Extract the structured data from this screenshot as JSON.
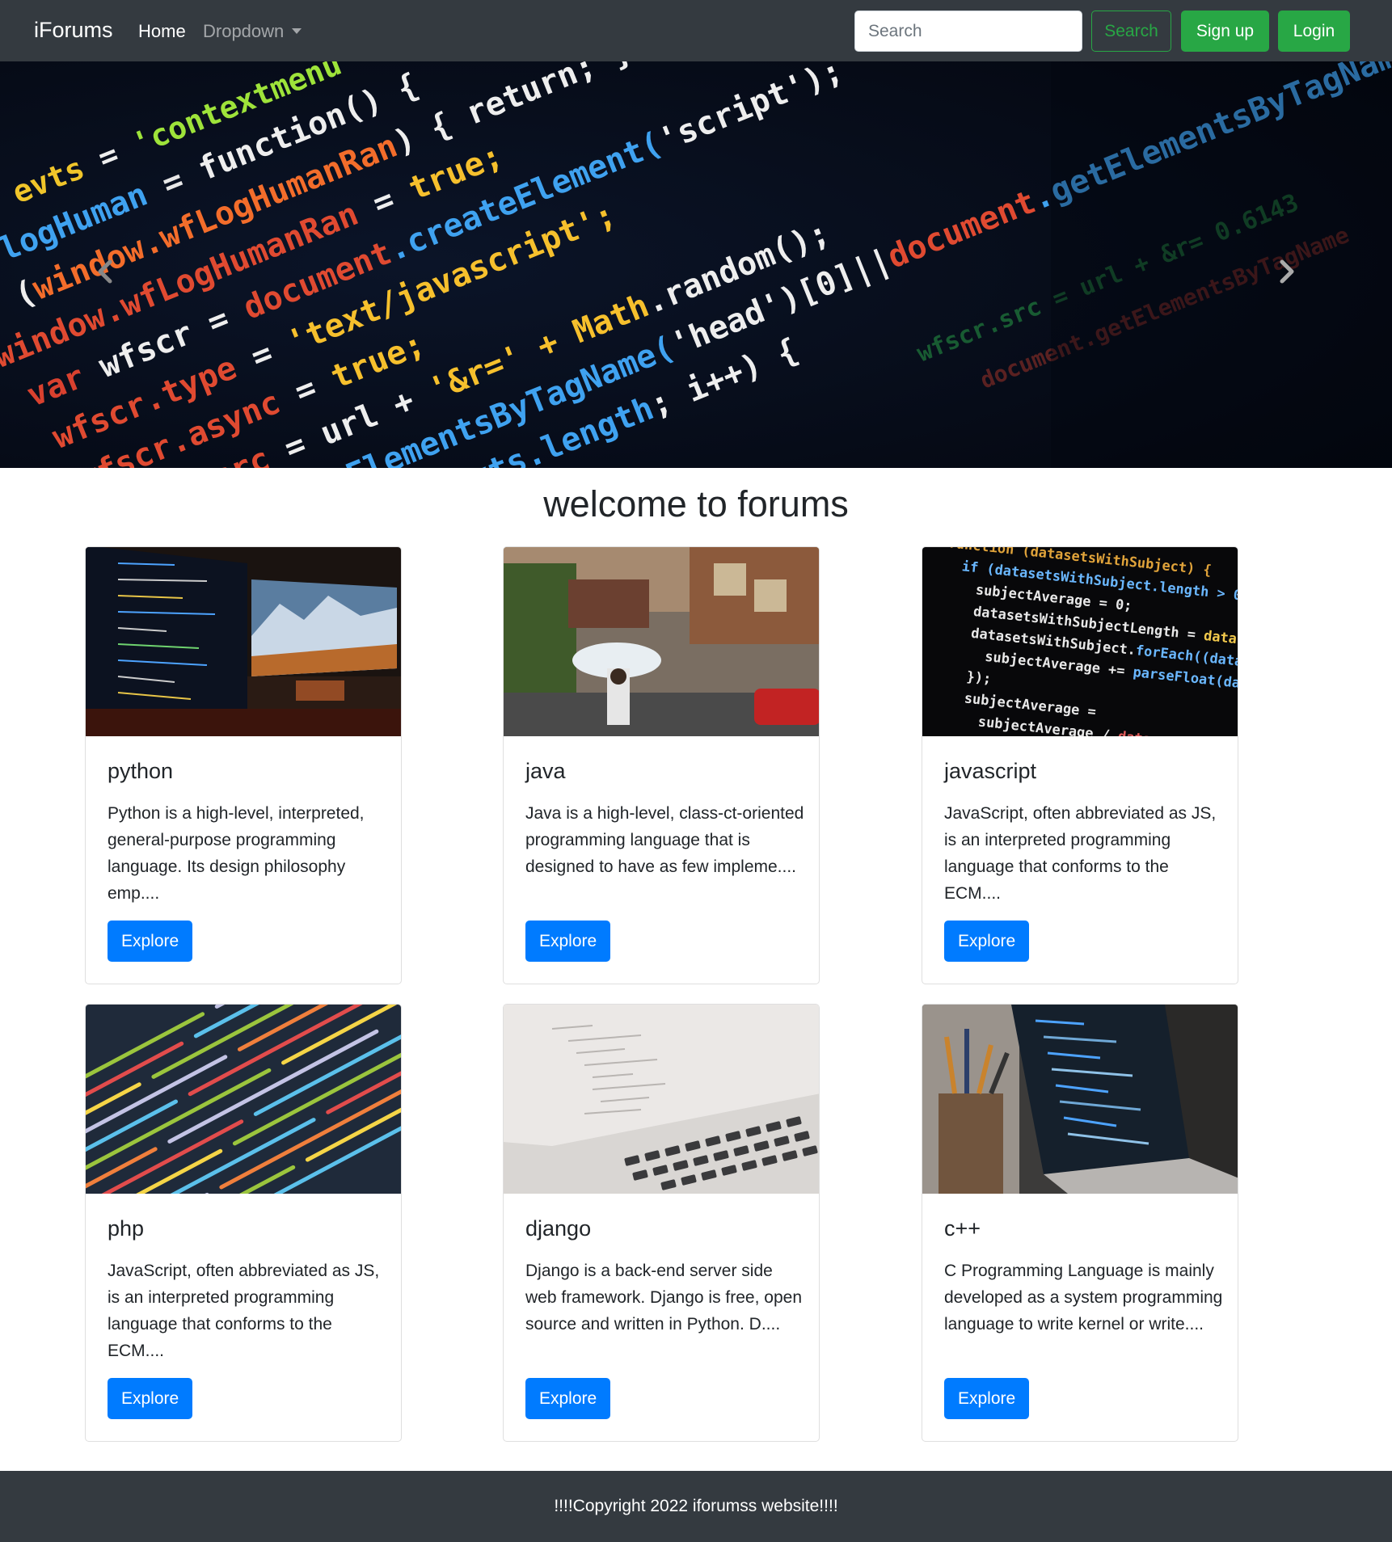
{
  "navbar": {
    "brand": "iForums",
    "home": "Home",
    "dropdown": "Dropdown",
    "search_placeholder": "Search",
    "search_button": "Search",
    "signup_button": "Sign up",
    "login_button": "Login",
    "colors": {
      "bg": "#343a40",
      "success": "#28a745"
    }
  },
  "carousel": {
    "prev_icon": "chevron-left-icon",
    "next_icon": "chevron-right-icon"
  },
  "main": {
    "title": "welcome to forums",
    "cards": [
      {
        "title": "python",
        "text": "Python is a high-level, interpreted, general-purpose programming language. Its design philosophy emp....",
        "button": "Explore"
      },
      {
        "title": "java",
        "text": "Java is a high-level, class-ct-oriented programming language that is designed to have as few impleme....",
        "button": "Explore"
      },
      {
        "title": "javascript",
        "text": "JavaScript, often abbreviated as JS, is an interpreted programming language that conforms to the ECM....",
        "button": "Explore"
      },
      {
        "title": "php",
        "text": "JavaScript, often abbreviated as JS, is an interpreted programming language that conforms to the ECM....",
        "button": "Explore"
      },
      {
        "title": "django",
        "text": "Django is a back-end server side web framework. Django is free, open source and written in Python. D....",
        "button": "Explore"
      },
      {
        "title": "c++",
        "text": "C Programming Language is mainly developed as a system programming language to write kernel or write....",
        "button": "Explore"
      }
    ],
    "colors": {
      "primary": "#007bff"
    }
  },
  "footer": {
    "text": "!!!!Copyright 2022 iforumss website!!!!"
  }
}
